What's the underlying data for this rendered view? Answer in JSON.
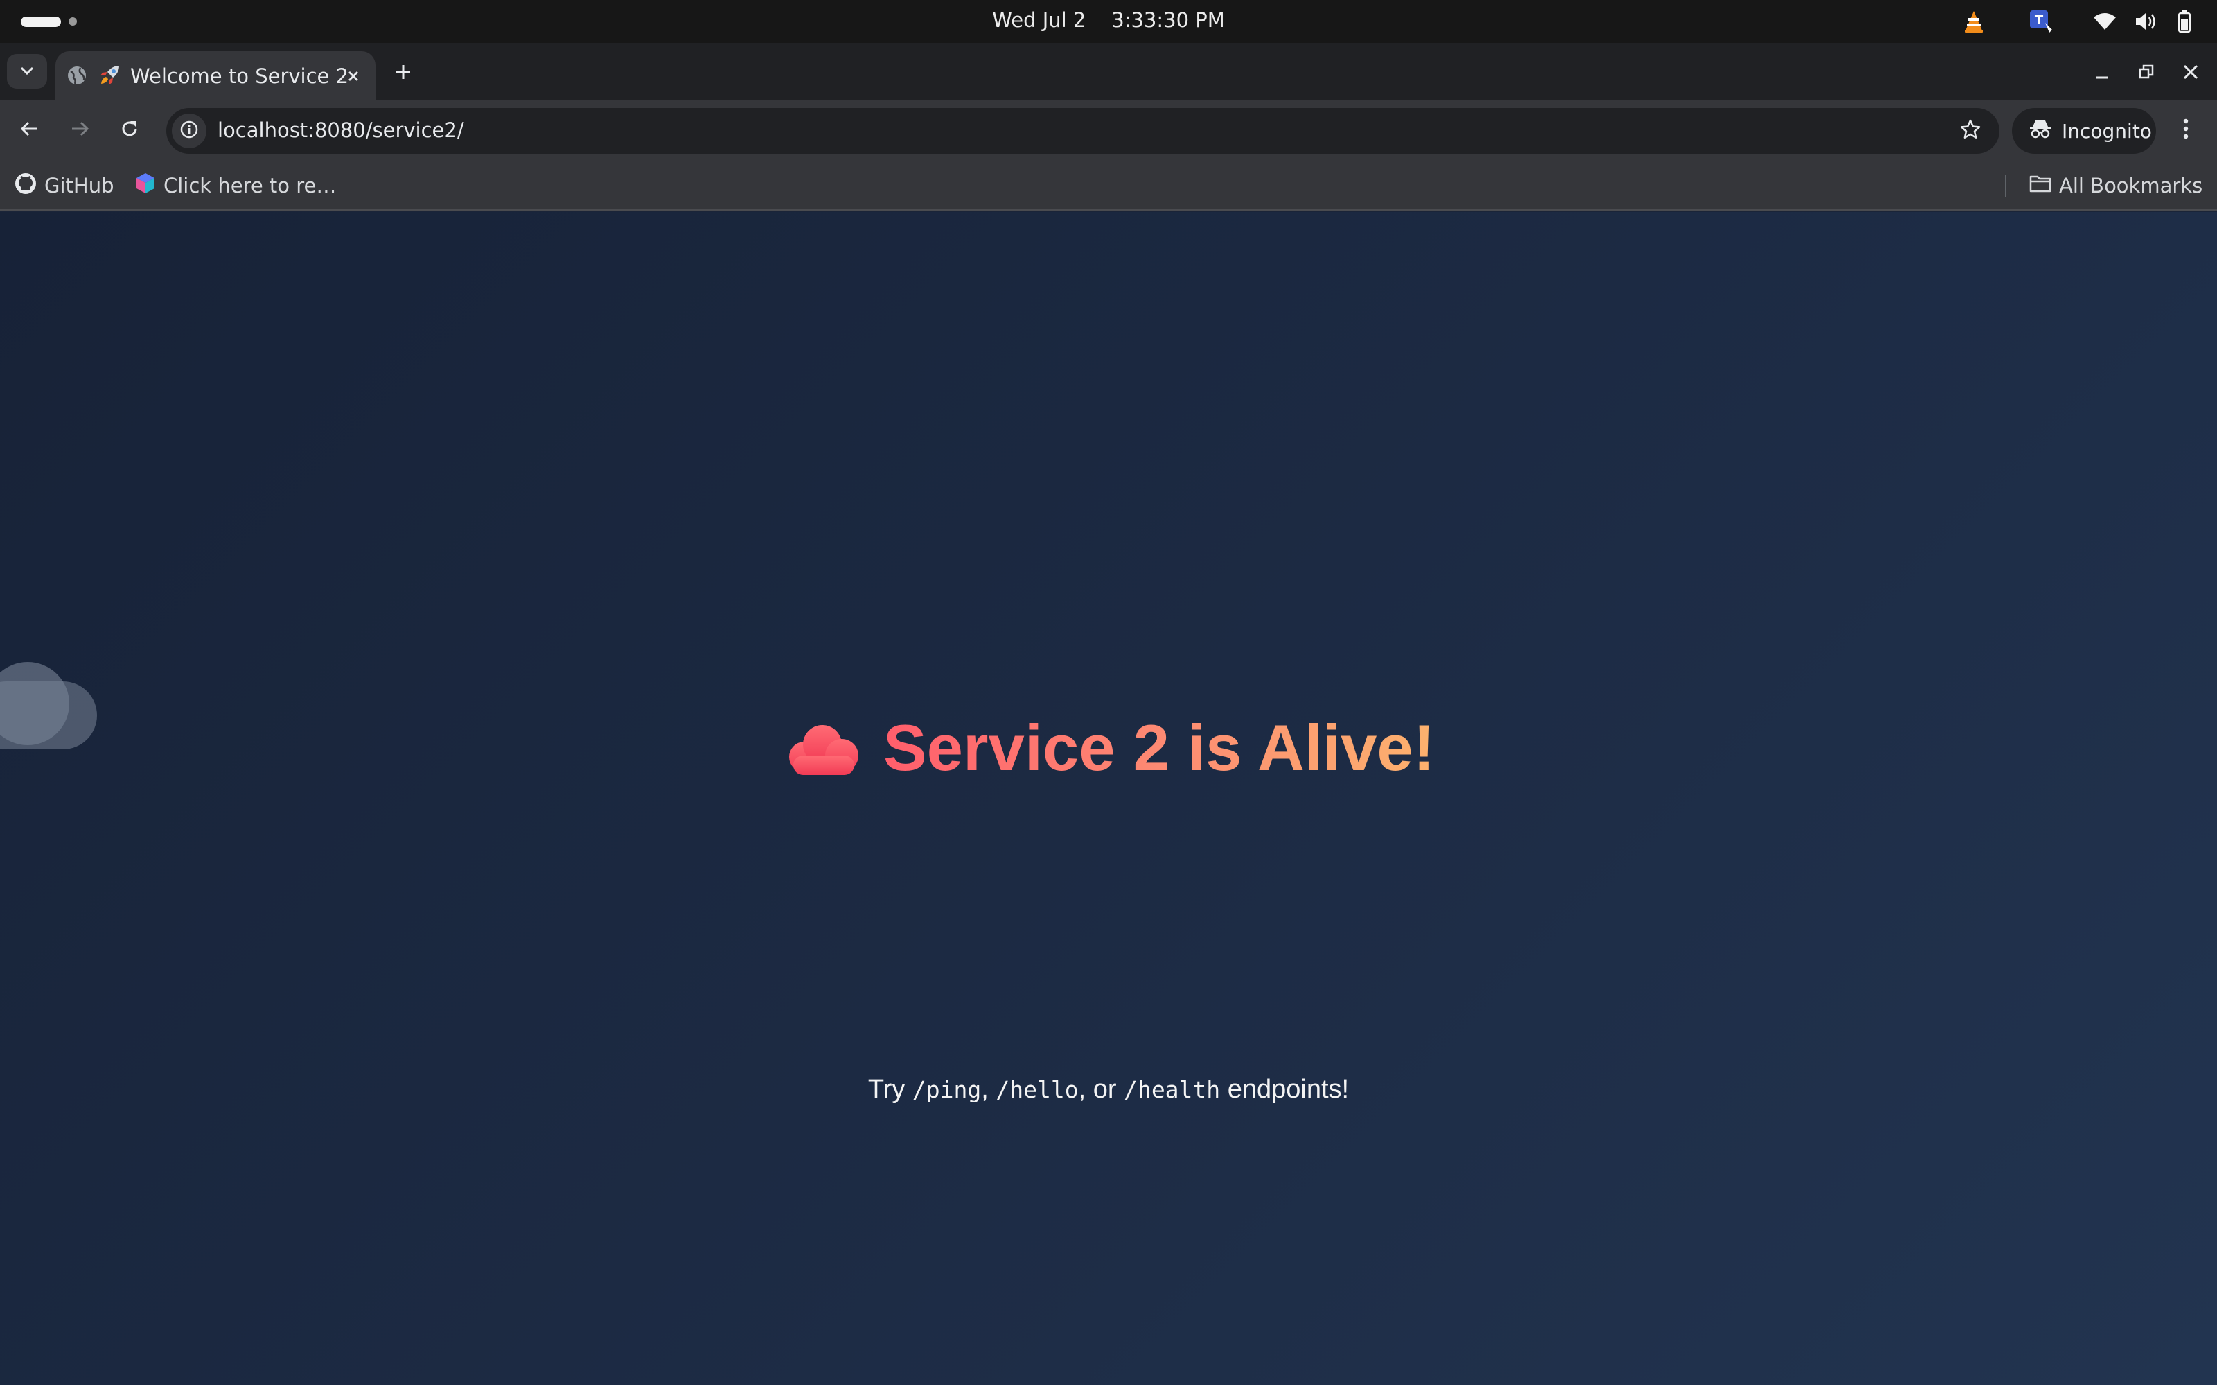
{
  "os": {
    "date": "Wed Jul 2",
    "time": "3:33:30 PM",
    "clock_text": "Wed Jul 2    3:33:30 PM",
    "tray_icons": [
      "vlc-icon",
      "translate-icon",
      "wifi-icon",
      "volume-icon",
      "battery-icon"
    ]
  },
  "browser": {
    "tab": {
      "emoji": "🚀",
      "title": "Welcome to Service 2"
    },
    "url": "localhost:8080/service2/",
    "incognito_label": "Incognito",
    "bookmarks": [
      {
        "label": "GitHub",
        "icon": "github-icon"
      },
      {
        "label": "Click here to re…",
        "icon": "cube-icon"
      }
    ],
    "all_bookmarks_label": "All Bookmarks"
  },
  "page": {
    "title_emoji": "☁️",
    "title": "Service 2 is Alive!",
    "sub_prefix": "Try ",
    "endpoint_1": "/ping",
    "sep_1": ", ",
    "endpoint_2": "/hello",
    "sep_2": ", or ",
    "endpoint_3": "/health",
    "sub_suffix": " endpoints!",
    "colors": {
      "gradient_start": "#ff5e6c",
      "gradient_end": "#fcb26e",
      "background": "#1c2a43"
    }
  }
}
